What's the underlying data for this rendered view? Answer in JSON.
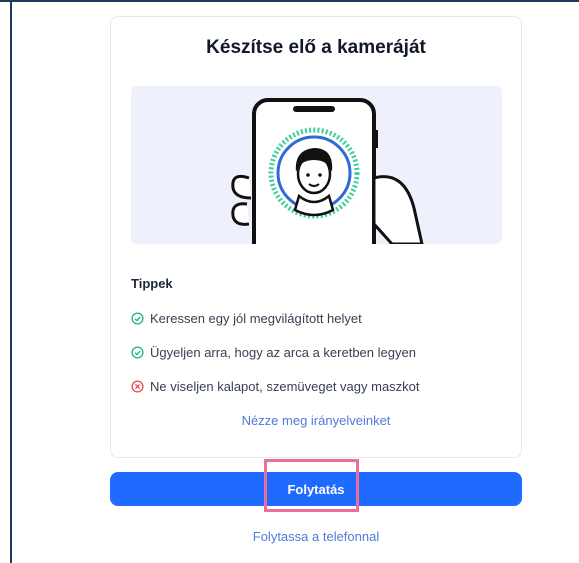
{
  "card": {
    "title": "Készítse elő a kameráját",
    "tips_heading": "Tippek",
    "tips": [
      {
        "text": "Keressen egy jól megvilágított helyet",
        "status": "ok",
        "icon": "check-circle-icon"
      },
      {
        "text": "Ügyeljen arra, hogy az arca a keretben legyen",
        "status": "ok",
        "icon": "check-circle-icon"
      },
      {
        "text": "Ne viseljen kalapot, szemüveget vagy maszkot",
        "status": "bad",
        "icon": "x-circle-icon"
      }
    ],
    "guidelines_link": "Nézze meg irányelveinket"
  },
  "actions": {
    "continue_label": "Folytatás",
    "phone_link": "Folytassa a telefonnal"
  },
  "colors": {
    "primary": "#1f6bff",
    "link": "#4f7bd9",
    "ok": "#22b07d",
    "bad": "#e5484d",
    "highlight": "#e8719a"
  }
}
